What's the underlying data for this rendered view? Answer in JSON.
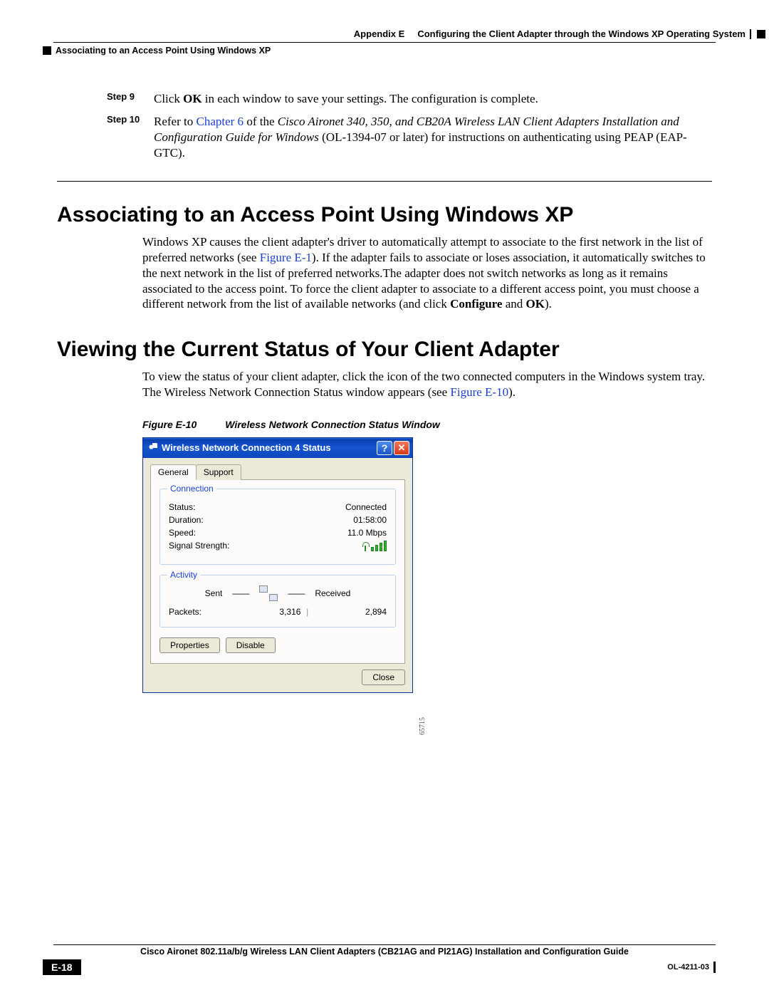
{
  "header": {
    "appendix": "Appendix E",
    "chapter_title": "Configuring the Client Adapter through the Windows XP Operating System",
    "section_breadcrumb": "Associating to an Access Point Using Windows XP"
  },
  "steps": {
    "step9": {
      "label": "Step 9",
      "pre": "Click ",
      "bold1": "OK",
      "post": " in each window to save your settings. The configuration is complete."
    },
    "step10": {
      "label": "Step 10",
      "pre": "Refer to ",
      "link": "Chapter 6",
      "mid1": " of the ",
      "italic": "Cisco Aironet 340, 350, and CB20A Wireless LAN Client Adapters Installation and Configuration Guide for Windows",
      "mid2": " (OL-1394-07 or later) for instructions on authenticating using PEAP (EAP-GTC)."
    }
  },
  "section1": {
    "title": "Associating to an Access Point Using Windows XP",
    "para_pre": "Windows XP causes the client adapter's driver to automatically attempt to associate to the first network in the list of preferred networks (see ",
    "para_link": "Figure E-1",
    "para_mid": "). If the adapter fails to associate or loses association, it automatically switches to the next network in the list of preferred networks.The adapter does not switch networks as long as it remains associated to the access point. To force the client adapter to associate to a different access point, you must choose a different network from the list of available networks (and click ",
    "para_bold1": "Configure",
    "para_and": " and ",
    "para_bold2": "OK",
    "para_end": ")."
  },
  "section2": {
    "title": "Viewing the Current Status of Your Client Adapter",
    "para_pre": "To view the status of your client adapter, click the icon of the two connected computers in the Windows system tray. The Wireless Network Connection Status window appears (see ",
    "para_link": "Figure E-10",
    "para_end": ")."
  },
  "figure": {
    "label": "Figure E-10",
    "caption": "Wireless Network Connection Status Window",
    "side_id": "65715"
  },
  "xp": {
    "title": "Wireless Network Connection 4 Status",
    "tabs": {
      "general": "General",
      "support": "Support"
    },
    "group_connection": "Connection",
    "status_label": "Status:",
    "status_value": "Connected",
    "duration_label": "Duration:",
    "duration_value": "01:58:00",
    "speed_label": "Speed:",
    "speed_value": "11.0 Mbps",
    "signal_label": "Signal Strength:",
    "group_activity": "Activity",
    "sent": "Sent",
    "received": "Received",
    "packets_label": "Packets:",
    "packets_sent": "3,316",
    "packets_recv": "2,894",
    "btn_properties": "Properties",
    "btn_disable": "Disable",
    "btn_close": "Close"
  },
  "footer": {
    "guide": "Cisco Aironet 802.11a/b/g Wireless LAN Client Adapters (CB21AG and PI21AG) Installation and Configuration Guide",
    "page": "E-18",
    "doc": "OL-4211-03"
  }
}
